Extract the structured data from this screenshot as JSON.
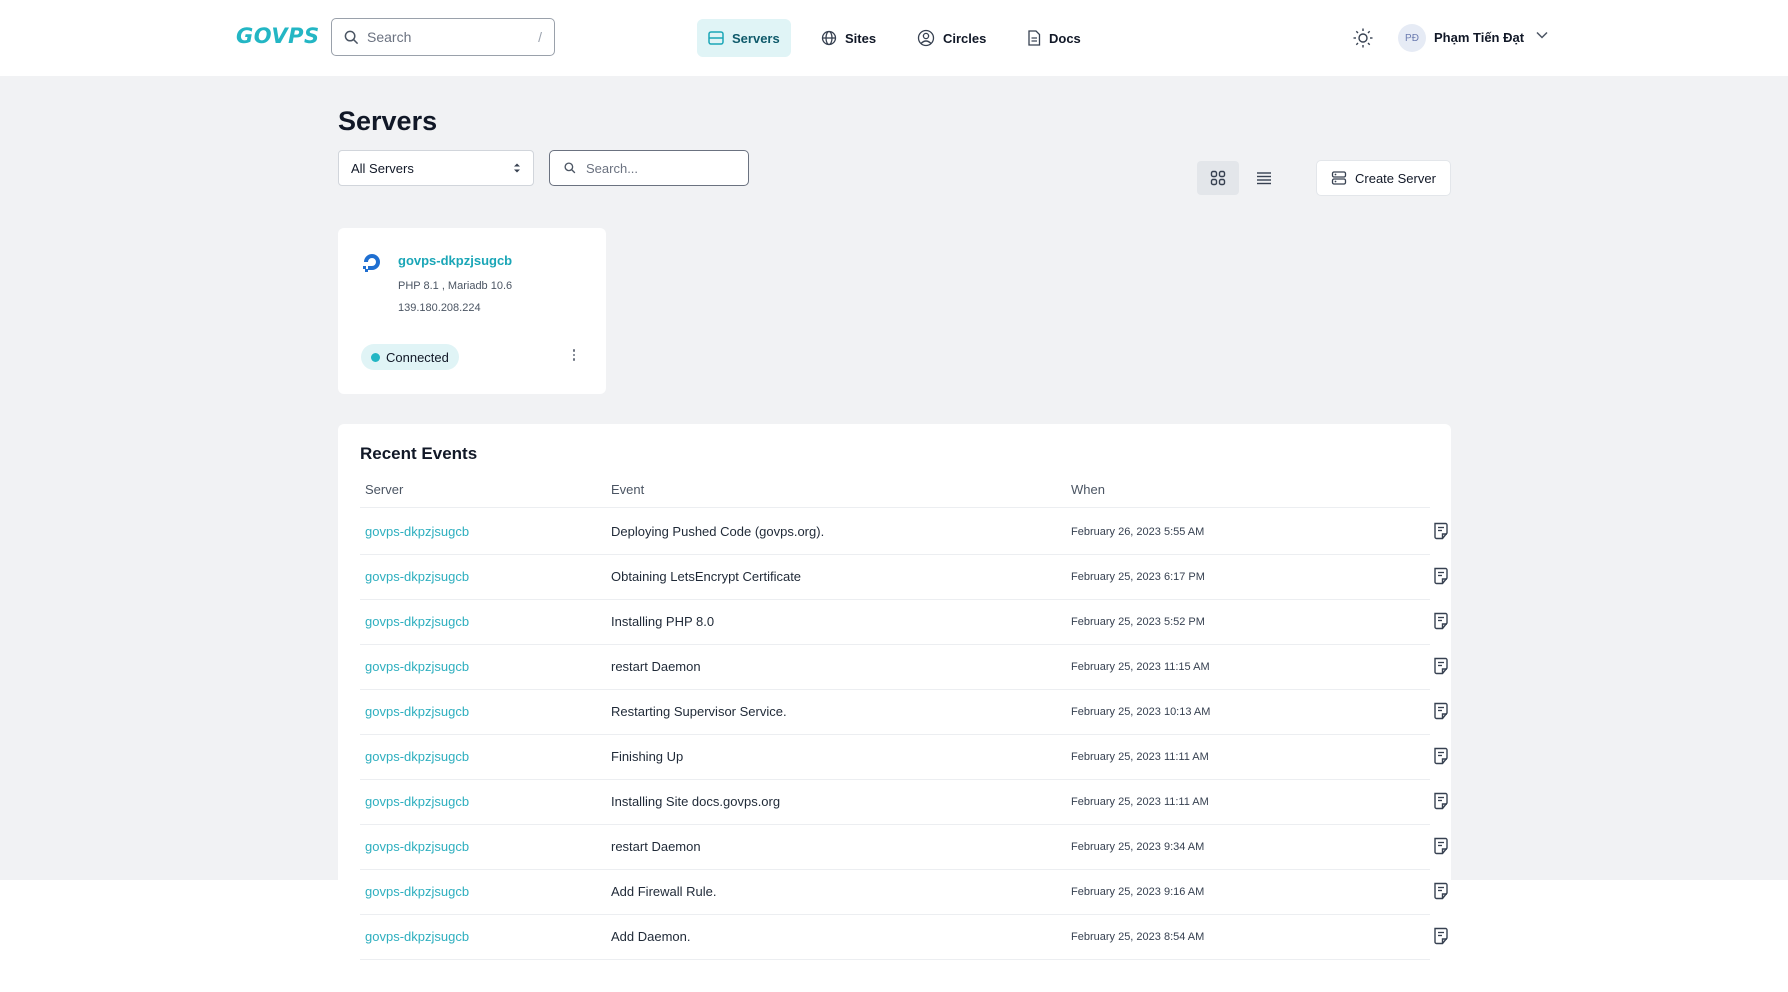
{
  "brand": {
    "logo": "GOVPS"
  },
  "topbar": {
    "search_placeholder": "Search",
    "search_shortcut": "/",
    "nav": [
      {
        "label": "Servers",
        "icon": "server-icon",
        "active": true
      },
      {
        "label": "Sites",
        "icon": "globe-icon",
        "active": false
      },
      {
        "label": "Circles",
        "icon": "user-circle-icon",
        "active": false
      },
      {
        "label": "Docs",
        "icon": "document-icon",
        "active": false
      }
    ],
    "user": {
      "initials": "PĐ",
      "name": "Phạm Tiến Đạt"
    }
  },
  "page": {
    "title": "Servers",
    "filter_value": "All Servers",
    "search_placeholder": "Search...",
    "create_button": "Create Server"
  },
  "server_card": {
    "name": "govps-dkpzjsugcb",
    "stack": "PHP 8.1 , Mariadb 10.6",
    "ip": "139.180.208.224",
    "status": "Connected"
  },
  "events": {
    "title": "Recent Events",
    "columns": {
      "server": "Server",
      "event": "Event",
      "when": "When"
    },
    "rows": [
      {
        "server": "govps-dkpzjsugcb",
        "event": "Deploying Pushed Code (govps.org).",
        "when": "February 26, 2023 5:55 AM"
      },
      {
        "server": "govps-dkpzjsugcb",
        "event": "Obtaining LetsEncrypt Certificate",
        "when": "February 25, 2023 6:17 PM"
      },
      {
        "server": "govps-dkpzjsugcb",
        "event": "Installing PHP 8.0",
        "when": "February 25, 2023 5:52 PM"
      },
      {
        "server": "govps-dkpzjsugcb",
        "event": "restart Daemon",
        "when": "February 25, 2023 11:15 AM"
      },
      {
        "server": "govps-dkpzjsugcb",
        "event": "Restarting Supervisor Service.",
        "when": "February 25, 2023 10:13 AM"
      },
      {
        "server": "govps-dkpzjsugcb",
        "event": "Finishing Up",
        "when": "February 25, 2023 11:11 AM"
      },
      {
        "server": "govps-dkpzjsugcb",
        "event": "Installing Site docs.govps.org",
        "when": "February 25, 2023 11:11 AM"
      },
      {
        "server": "govps-dkpzjsugcb",
        "event": "restart Daemon",
        "when": "February 25, 2023 9:34 AM"
      },
      {
        "server": "govps-dkpzjsugcb",
        "event": "Add Firewall Rule.",
        "when": "February 25, 2023 9:16 AM"
      },
      {
        "server": "govps-dkpzjsugcb",
        "event": "Add Daemon.",
        "when": "February 25, 2023 8:54 AM"
      }
    ]
  },
  "colors": {
    "accent": "#23b6c4",
    "link": "#2eafbf",
    "background": "#f1f2f4"
  }
}
